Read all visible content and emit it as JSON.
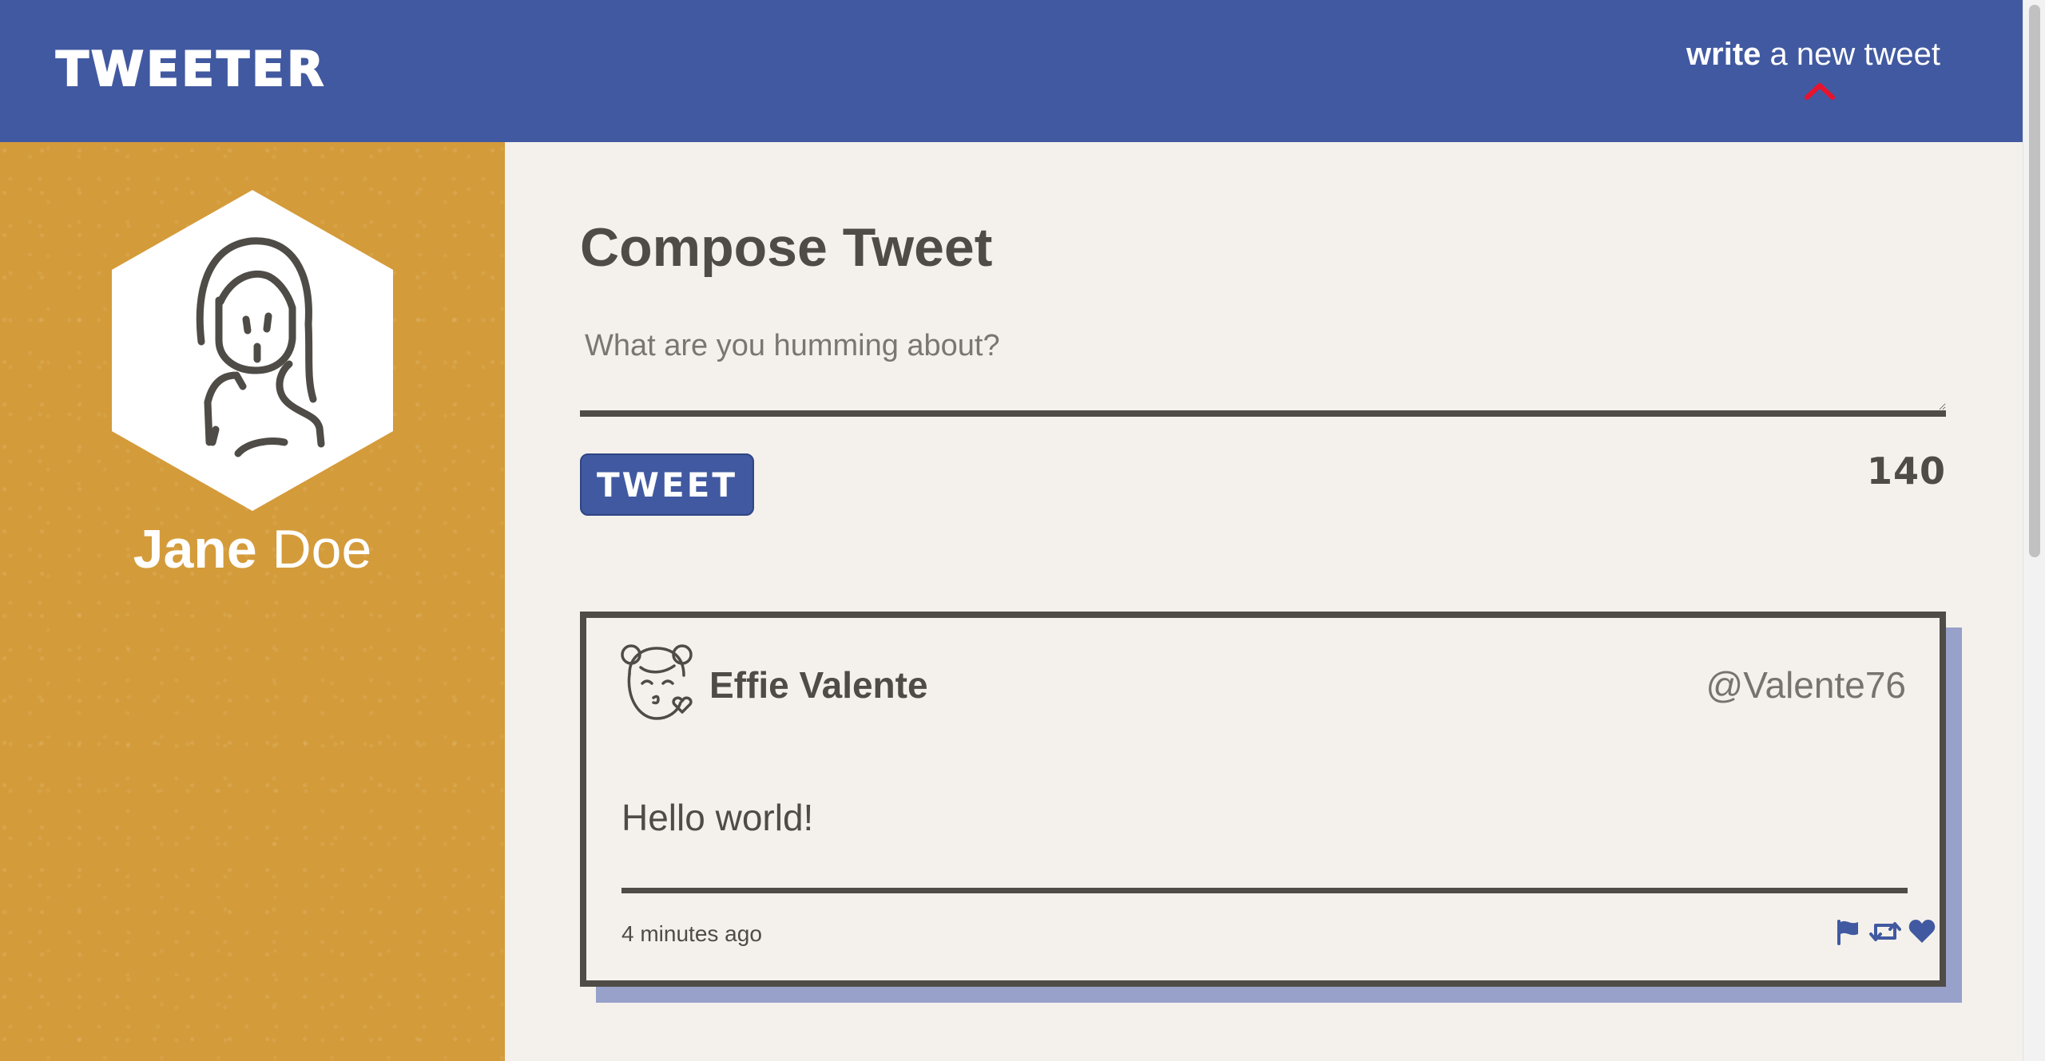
{
  "nav": {
    "brand": "TWEETER",
    "compose_bold": "write",
    "compose_rest": " a new tweet",
    "arrow_color": "#e8132d"
  },
  "profile": {
    "first_name": "Jane",
    "last_name": " Doe",
    "avatar_icon": "woman-avatar-icon"
  },
  "compose": {
    "title": "Compose Tweet",
    "placeholder": "What are you humming about?",
    "button_label": "TWEET",
    "counter": "140"
  },
  "tweets": [
    {
      "avatar_icon": "girl-kiss-avatar-icon",
      "name": "Effie Valente",
      "handle": "@Valente76",
      "content": "Hello world!",
      "time": "4 minutes ago",
      "actions": [
        "flag-icon",
        "retweet-icon",
        "heart-icon"
      ]
    }
  ],
  "colors": {
    "nav_bg": "#4159a0",
    "sidebar_bg": "#d49b3a",
    "page_bg": "#f4f1ec",
    "text": "#4f4c47",
    "shadow": "#97a1c9"
  }
}
